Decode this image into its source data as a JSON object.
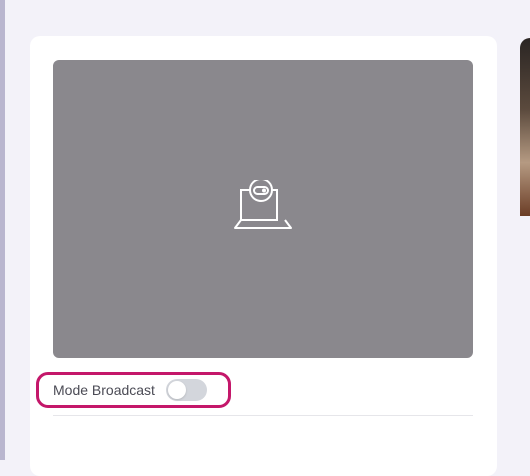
{
  "preview": {
    "icon": "webcam-laptop-icon",
    "background_color": "#8a888d"
  },
  "broadcast": {
    "label": "Mode Broadcast",
    "enabled": false,
    "highlight_color": "#c4176a"
  },
  "side_panel": {
    "image": "camera-feed-thumbnail"
  }
}
